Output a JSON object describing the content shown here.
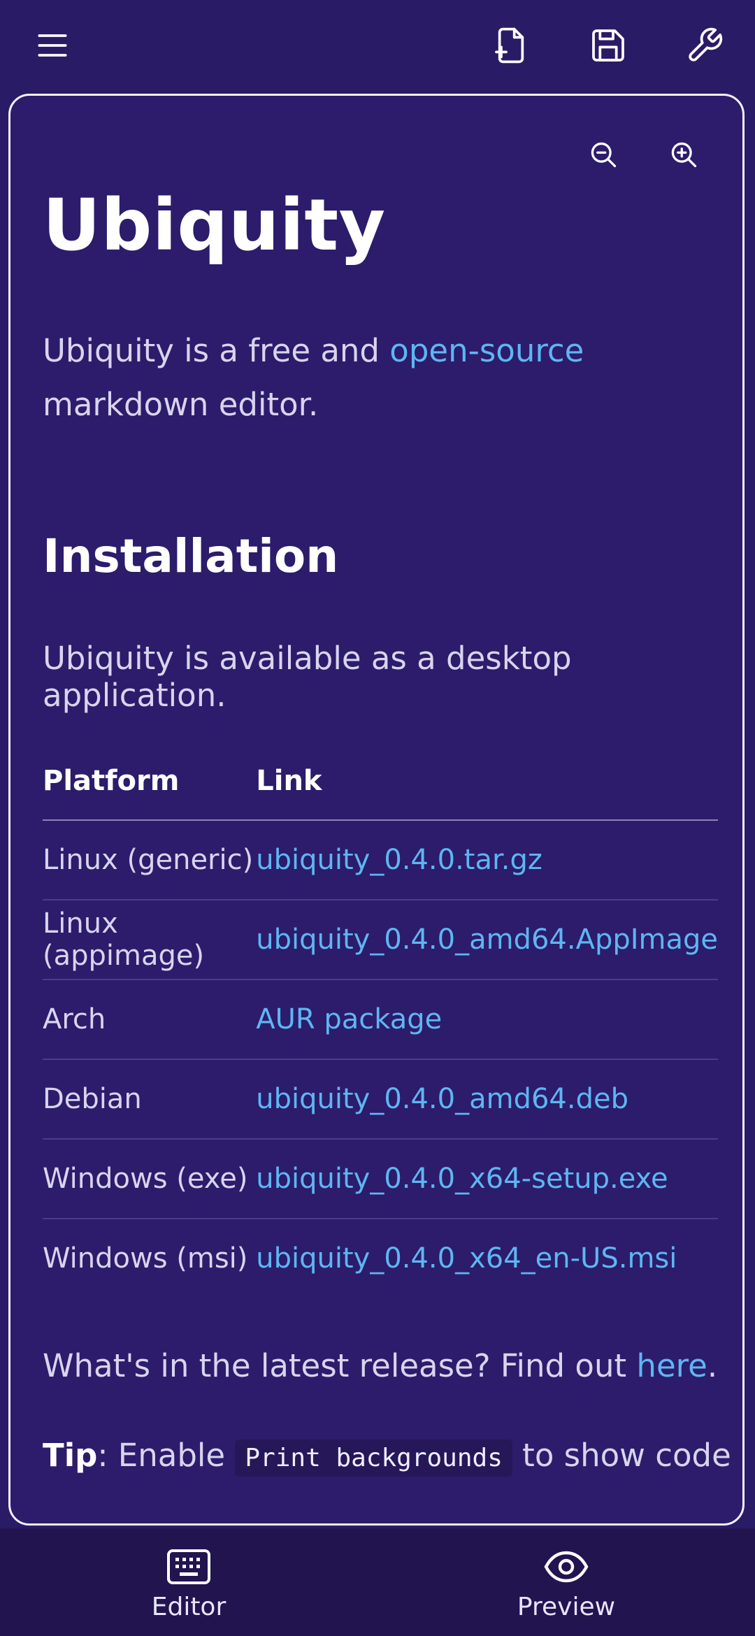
{
  "toolbar": {
    "menu_icon": "hamburger-menu-icon",
    "new_file_icon": "new-file-icon",
    "save_icon": "save-icon",
    "settings_icon": "wrench-icon"
  },
  "preview": {
    "zoom_out_icon": "zoom-out-icon",
    "zoom_in_icon": "zoom-in-icon",
    "title": "Ubiquity",
    "intro_before": "Ubiquity is a free and ",
    "intro_link": "open-source",
    "intro_after": " markdown editor.",
    "installation_heading": "Installation",
    "available_text": "Ubiquity is available as a desktop application.",
    "table": {
      "headers": [
        "Platform",
        "Link"
      ],
      "rows": [
        {
          "platform": "Linux (generic)",
          "link": "ubiquity_0.4.0.tar.gz"
        },
        {
          "platform": "Linux (appimage)",
          "link": "ubiquity_0.4.0_amd64.AppImage"
        },
        {
          "platform": "Arch",
          "link": "AUR package"
        },
        {
          "platform": "Debian",
          "link": "ubiquity_0.4.0_amd64.deb"
        },
        {
          "platform": "Windows (exe)",
          "link": "ubiquity_0.4.0_x64-setup.exe"
        },
        {
          "platform": "Windows (msi)",
          "link": "ubiquity_0.4.0_x64_en-US.msi"
        }
      ]
    },
    "latest_before": "What's in the latest release? Find out ",
    "latest_link": "here",
    "latest_after": ".",
    "tip_label": "Tip",
    "tip_before": ": Enable ",
    "tip_code": "Print backgrounds",
    "tip_after": " to show code"
  },
  "bottom_nav": {
    "editor_label": "Editor",
    "preview_label": "Preview"
  },
  "colors": {
    "background": "#2a1b66",
    "link": "#5eb6f2",
    "nav_background": "#21144f"
  }
}
